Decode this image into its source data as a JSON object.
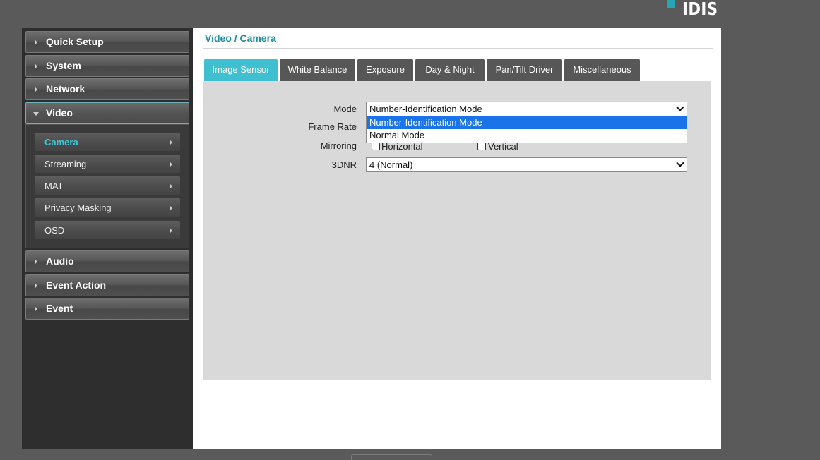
{
  "brand": {
    "logo_text": "IDIS",
    "accent": "#27a6b5"
  },
  "sidebar": {
    "items": [
      {
        "label": "Quick Setup"
      },
      {
        "label": "System"
      },
      {
        "label": "Network"
      },
      {
        "label": "Video"
      },
      {
        "label": "Audio"
      },
      {
        "label": "Event Action"
      },
      {
        "label": "Event"
      }
    ],
    "video_sub": [
      {
        "label": "Camera"
      },
      {
        "label": "Streaming"
      },
      {
        "label": "MAT"
      },
      {
        "label": "Privacy Masking"
      },
      {
        "label": "OSD"
      }
    ]
  },
  "main": {
    "title": "Video / Camera",
    "tabs": [
      {
        "label": "Image Sensor"
      },
      {
        "label": "White Balance"
      },
      {
        "label": "Exposure"
      },
      {
        "label": "Day & Night"
      },
      {
        "label": "Pan/Tilt Driver"
      },
      {
        "label": "Miscellaneous"
      }
    ],
    "form": {
      "mode_label": "Mode",
      "mode_value": "Number-Identification Mode",
      "mode_options": [
        "Number-Identification Mode",
        "Normal Mode"
      ],
      "frame_rate_label": "Frame Rate",
      "mirroring_label": "Mirroring",
      "horizontal_label": "Horizontal",
      "vertical_label": "Vertical",
      "dnr_label": "3DNR",
      "dnr_value": "4 (Normal)"
    }
  },
  "colors": {
    "active_tab": "#3fbfcf",
    "title": "#1c8ea0",
    "selected_option": "#1a73e8"
  }
}
